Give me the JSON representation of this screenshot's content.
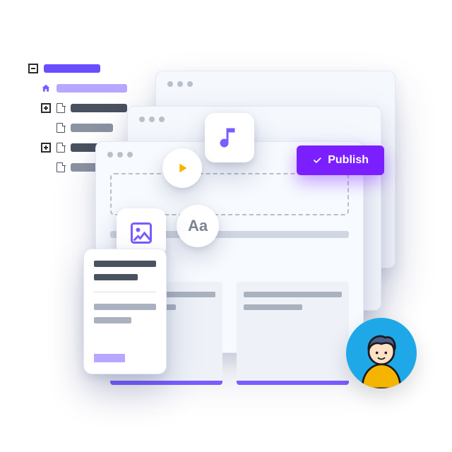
{
  "tree": {
    "items": [
      {
        "type": "collapse",
        "color": "purple-dk"
      },
      {
        "type": "home",
        "color": "purple-lt"
      },
      {
        "type": "expand",
        "color": "gray"
      },
      {
        "type": "doc",
        "color": "gray-lt"
      },
      {
        "type": "expand",
        "color": "gray"
      },
      {
        "type": "doc",
        "color": "gray-lt"
      }
    ]
  },
  "publish": {
    "label": "Publish"
  },
  "tiles": {
    "music_icon": "music-note",
    "image_icon": "picture",
    "play_icon": "play",
    "typography_label": "Aa"
  },
  "colors": {
    "accent": "#7b1fff",
    "accent_light": "#b8a7ff",
    "avatar_bg": "#1fa8e8",
    "avatar_shirt": "#f5b400"
  }
}
